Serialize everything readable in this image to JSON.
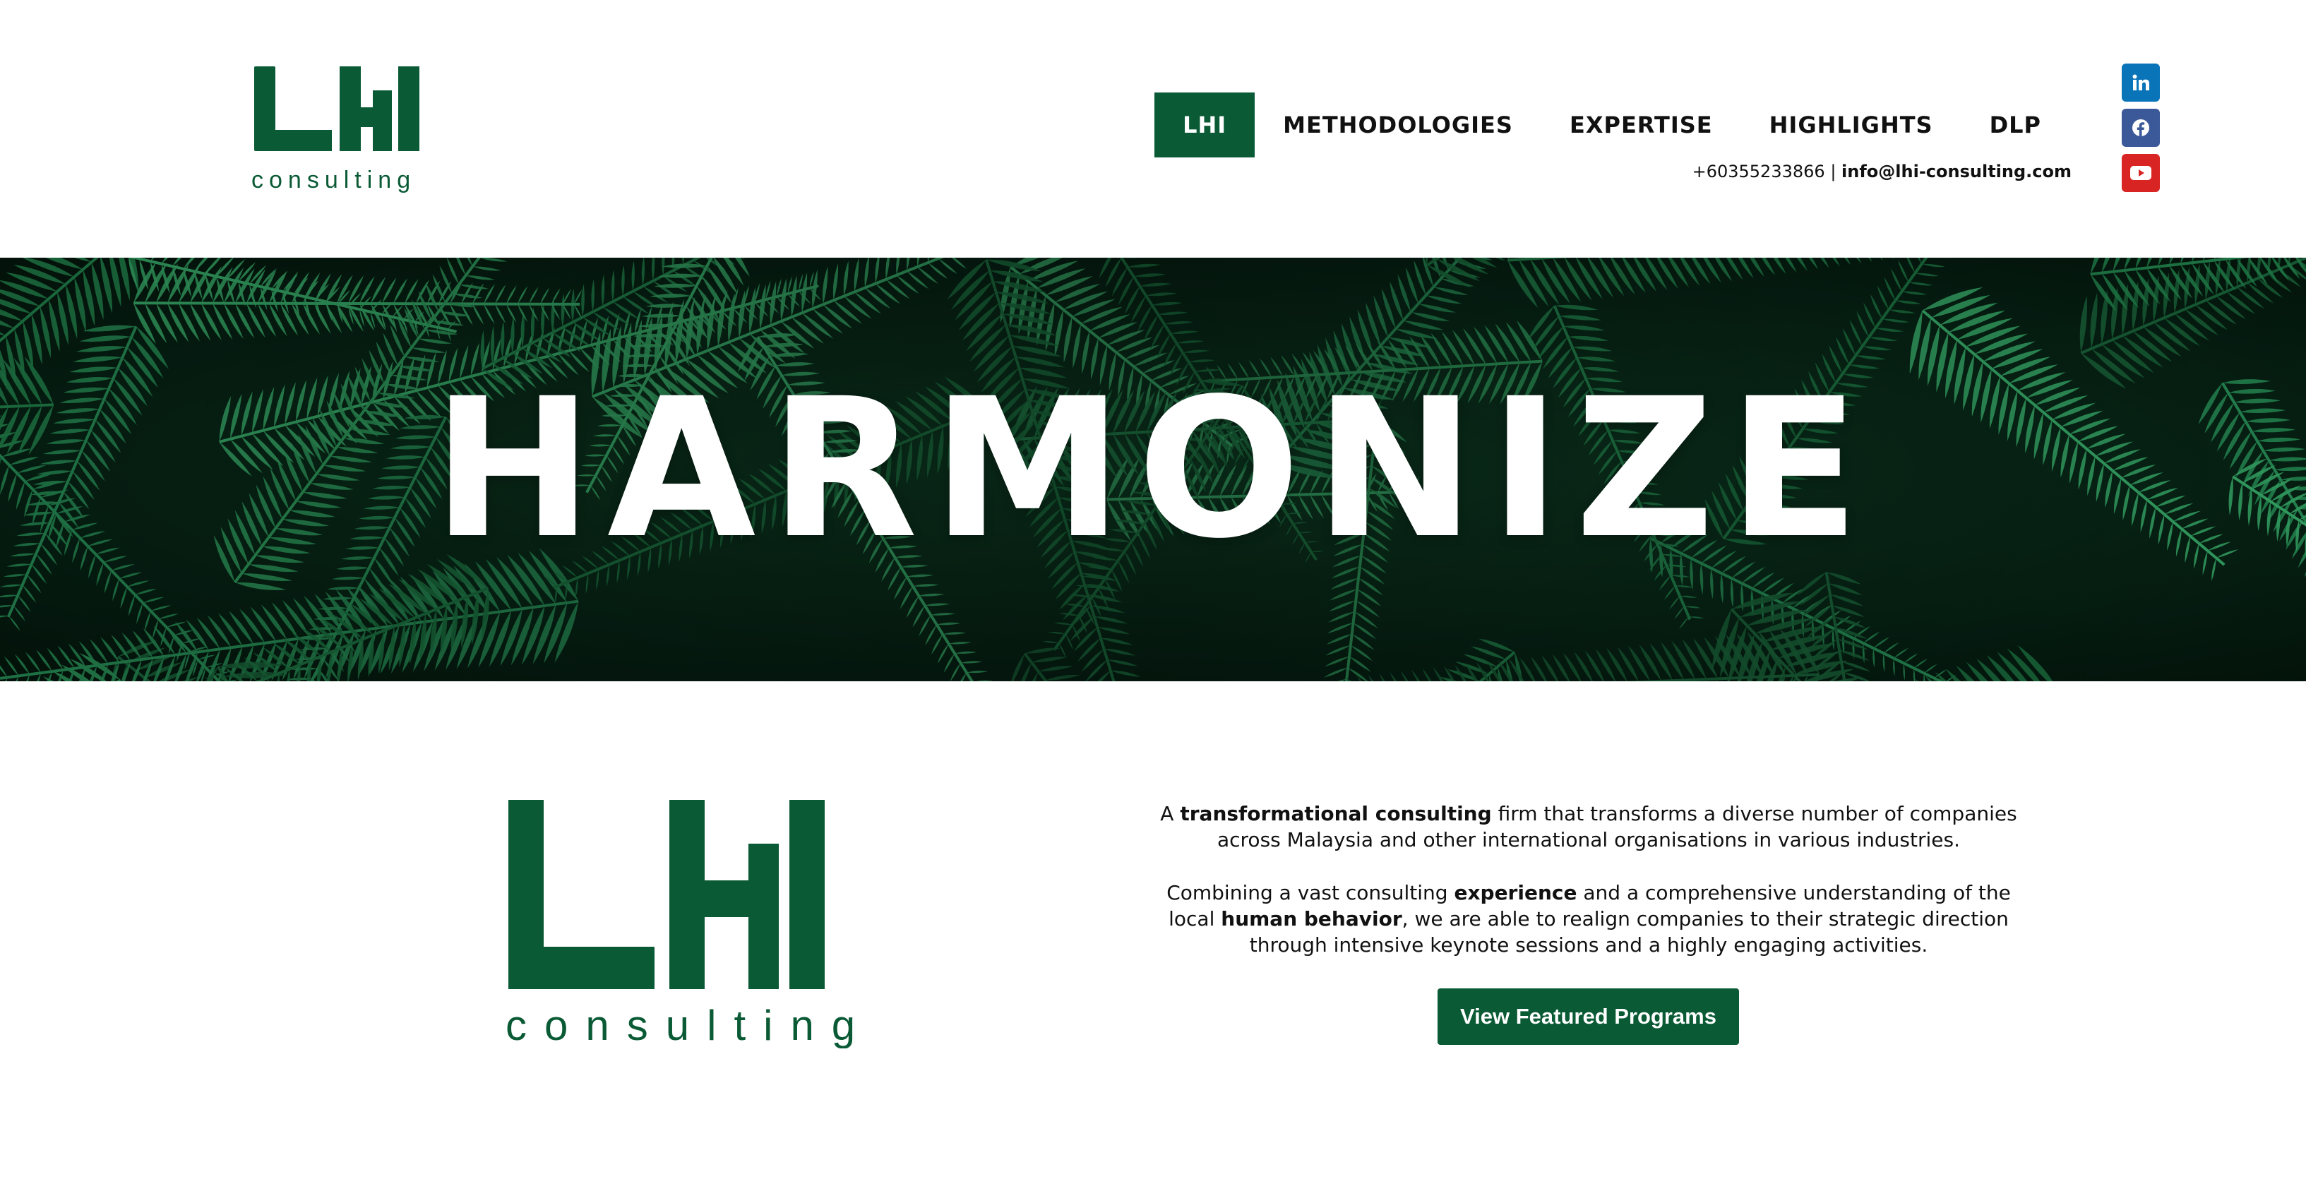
{
  "brand": {
    "logo_letters": "LHI",
    "logo_word": "consulting",
    "color_primary": "#0a5a35"
  },
  "nav": {
    "items": [
      {
        "label": "LHI",
        "active": true
      },
      {
        "label": "METHODOLOGIES",
        "active": false
      },
      {
        "label": "EXPERTISE",
        "active": false
      },
      {
        "label": "HIGHLIGHTS",
        "active": false
      },
      {
        "label": "DLP",
        "active": false
      }
    ]
  },
  "contact": {
    "phone": "+60355233866",
    "separator": "|",
    "email": "info@lhi-consulting.com"
  },
  "social": [
    {
      "name": "linkedin-icon",
      "label": "in",
      "color": "#0a74b8"
    },
    {
      "name": "facebook-icon",
      "label": "f",
      "color": "#3b5998"
    },
    {
      "name": "youtube-icon",
      "label": "▶",
      "color": "#d92424"
    }
  ],
  "hero": {
    "title": "HARMONIZE"
  },
  "about": {
    "p1_a": "A ",
    "p1_b": "transformational consulting",
    "p1_c": " firm that transforms a diverse number of companies across Malaysia and other international organisations in various industries.",
    "p2_a": "Combining a vast consulting ",
    "p2_b": "experience",
    "p2_c": " and a comprehensive understanding of the local ",
    "p2_d": "human behavior",
    "p2_e": ", we are able to realign companies to their strategic direction through intensive keynote sessions and  a highly engaging activities.",
    "cta_label": "View Featured Programs"
  }
}
